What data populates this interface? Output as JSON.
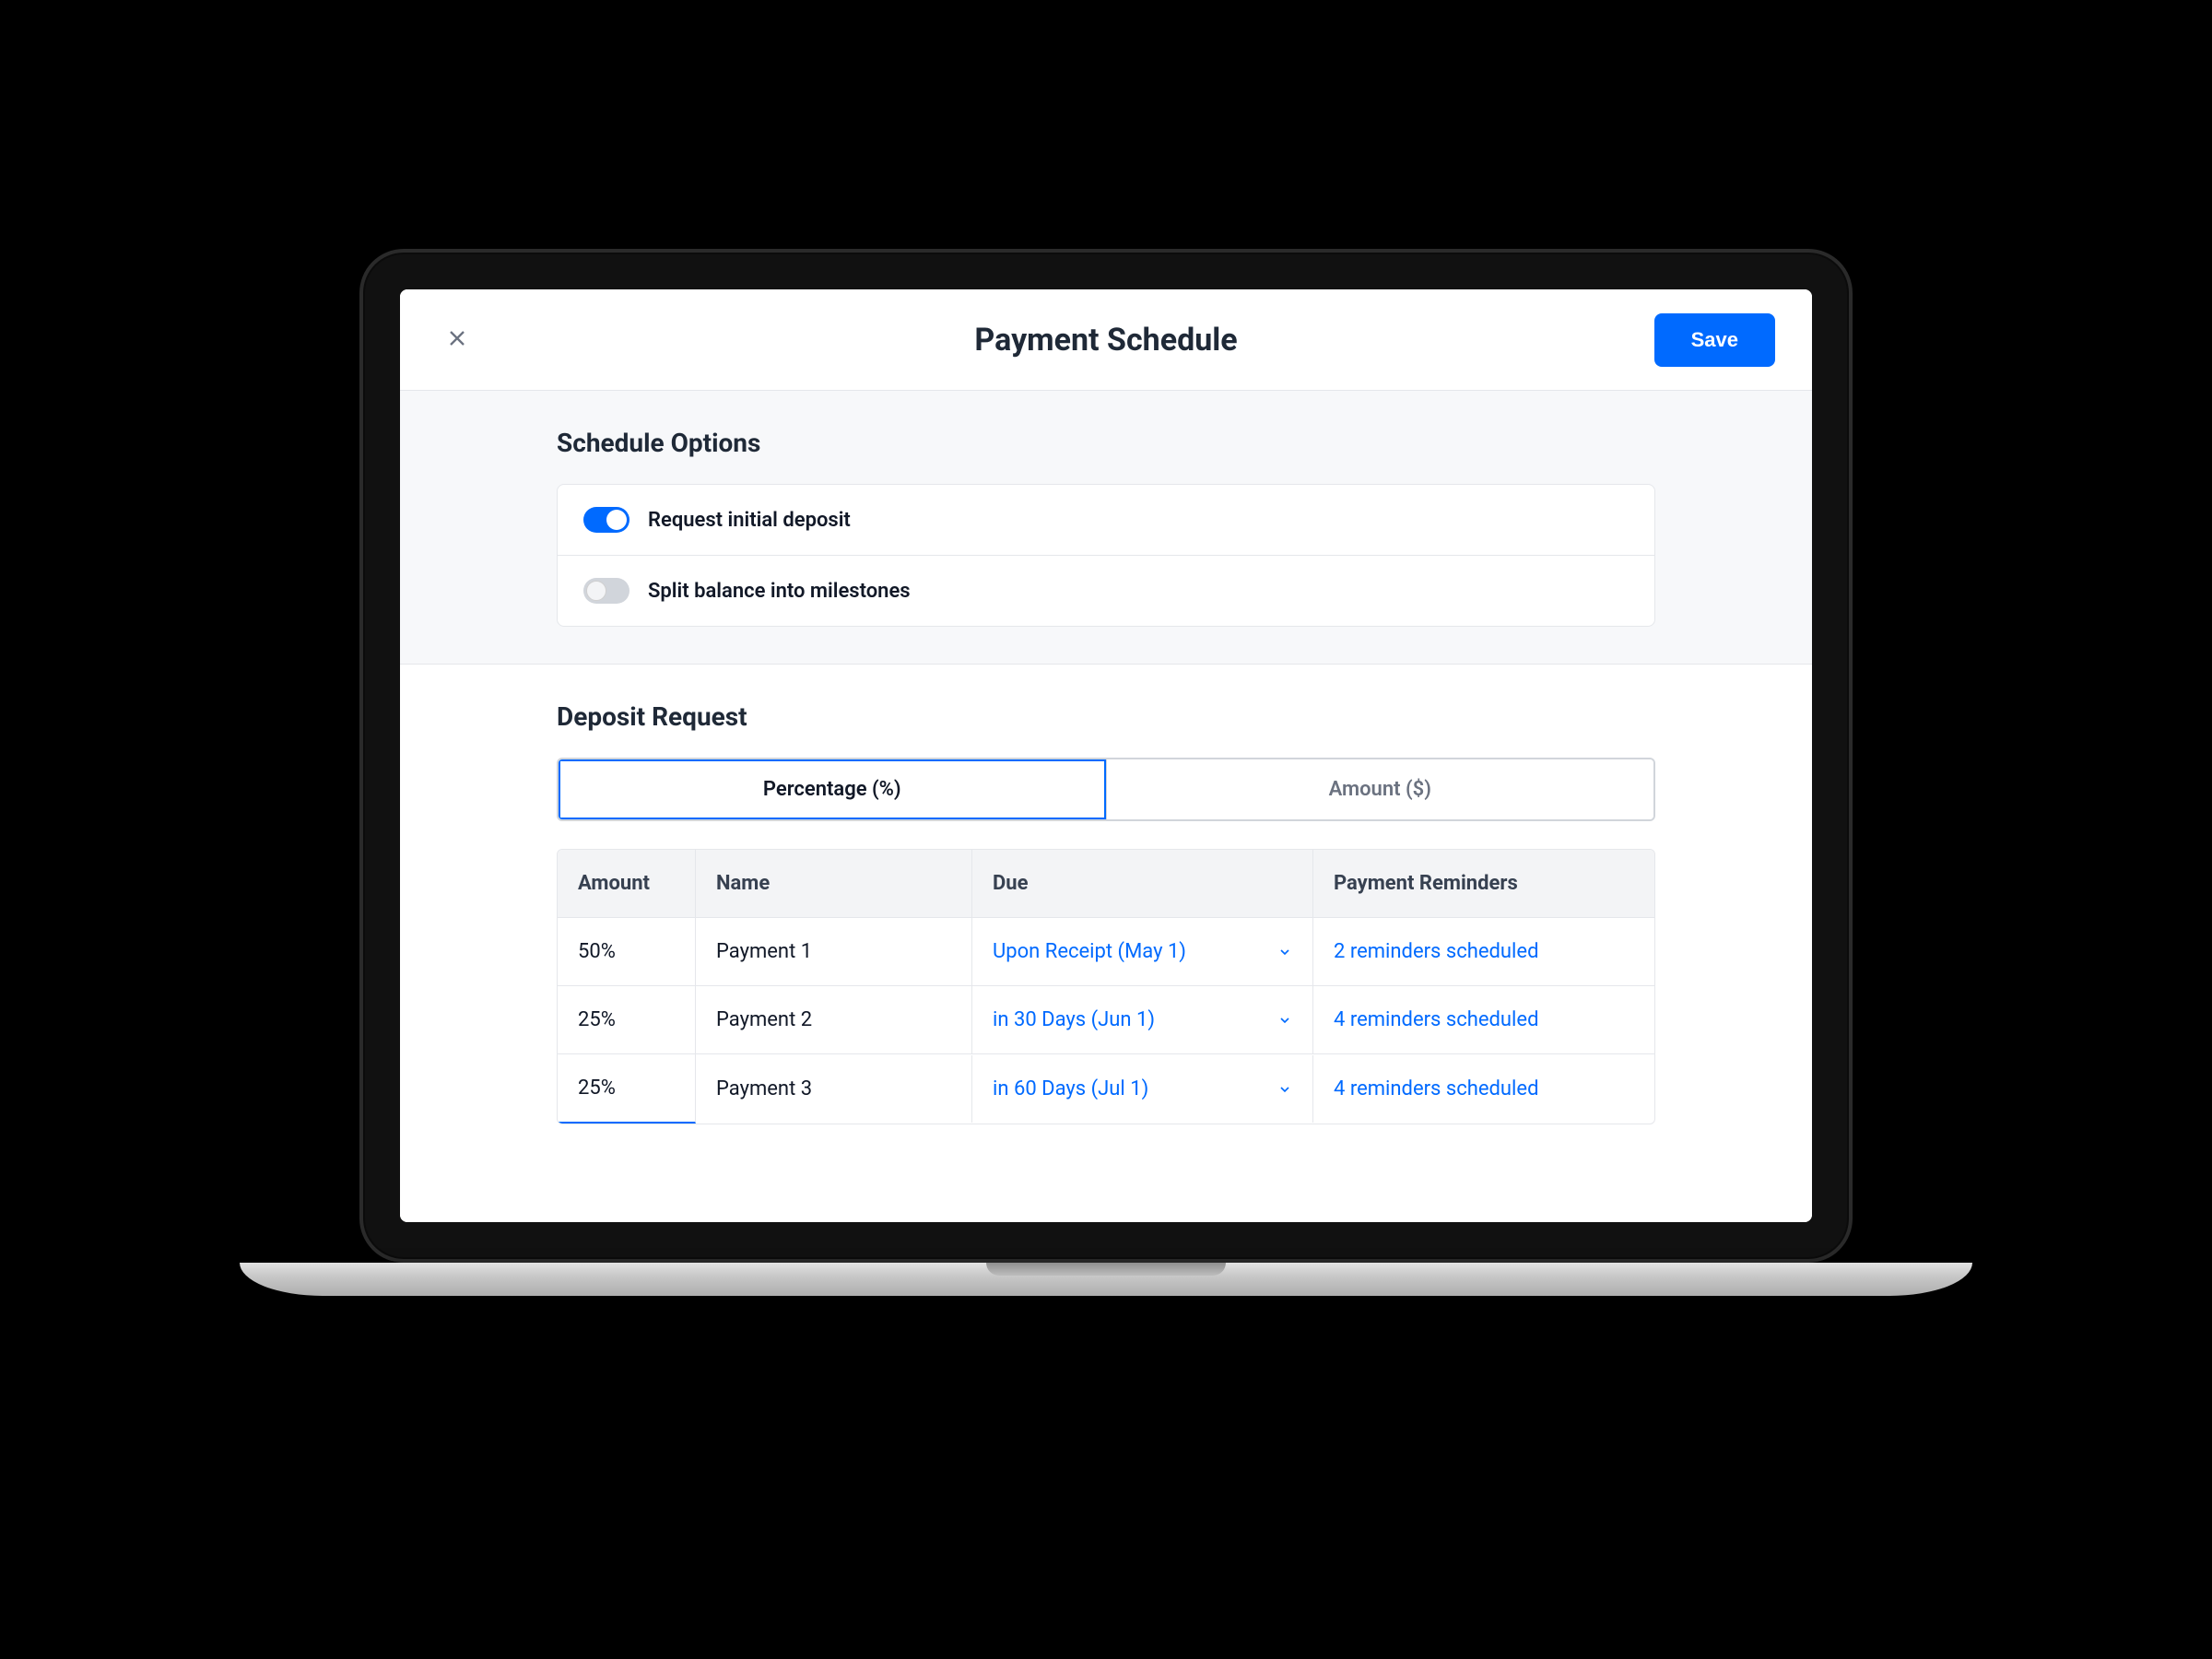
{
  "header": {
    "title": "Payment Schedule",
    "save_label": "Save"
  },
  "schedule_options": {
    "title": "Schedule Options",
    "items": [
      {
        "label": "Request initial deposit",
        "on": true
      },
      {
        "label": "Split balance into milestones",
        "on": false
      }
    ]
  },
  "deposit_request": {
    "title": "Deposit Request",
    "tabs": {
      "percentage": "Percentage (%)",
      "amount": "Amount ($)",
      "active": "percentage"
    },
    "columns": {
      "amount": "Amount",
      "name": "Name",
      "due": "Due",
      "reminders": "Payment Reminders"
    },
    "rows": [
      {
        "amount": "50%",
        "name": "Payment 1",
        "due": "Upon Receipt (May 1)",
        "reminders": "2 reminders scheduled"
      },
      {
        "amount": "25%",
        "name": "Payment 2",
        "due": "in 30 Days (Jun 1)",
        "reminders": "4 reminders scheduled"
      },
      {
        "amount": "25%",
        "name": "Payment 3",
        "due": "in 60 Days (Jul 1)",
        "reminders": "4 reminders scheduled"
      }
    ]
  }
}
